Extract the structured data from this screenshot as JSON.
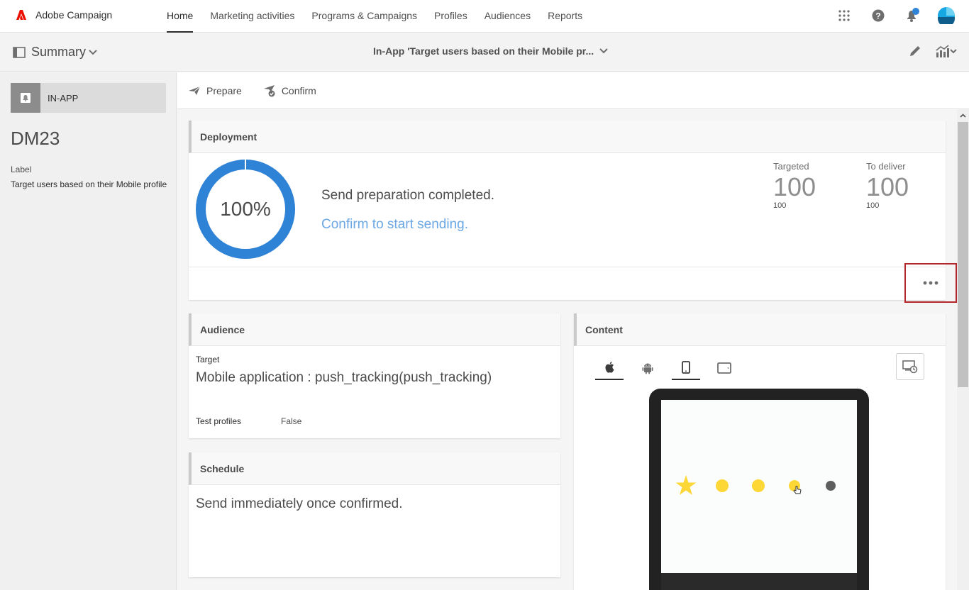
{
  "app": {
    "name": "Adobe Campaign"
  },
  "nav": {
    "items": [
      {
        "label": "Home",
        "active": true
      },
      {
        "label": "Marketing activities",
        "active": false
      },
      {
        "label": "Programs & Campaigns",
        "active": false
      },
      {
        "label": "Profiles",
        "active": false
      },
      {
        "label": "Audiences",
        "active": false
      },
      {
        "label": "Reports",
        "active": false
      }
    ],
    "icons": [
      "apps-grid-icon",
      "help-icon",
      "notification-bell-icon",
      "user-avatar-icon"
    ]
  },
  "subbar": {
    "summary_label": "Summary",
    "delivery_title": "In-App 'Target users based on their Mobile pr..."
  },
  "left": {
    "channel": "IN-APP",
    "code": "DM23",
    "label_caption": "Label",
    "label_value": "Target users based on their Mobile profile"
  },
  "toolbar": {
    "prepare": "Prepare",
    "confirm": "Confirm"
  },
  "deployment": {
    "title": "Deployment",
    "progress_percent": 100,
    "progress_text": "100%",
    "status": "Send preparation completed.",
    "link": "Confirm to start sending.",
    "targeted_label": "Targeted",
    "targeted_value": "100",
    "targeted_sub": "100",
    "deliver_label": "To deliver",
    "deliver_value": "100",
    "deliver_sub": "100"
  },
  "audience": {
    "title": "Audience",
    "target_label": "Target",
    "target_value": "Mobile application : push_tracking(push_tracking)",
    "test_label": "Test profiles",
    "test_value": "False"
  },
  "schedule": {
    "title": "Schedule",
    "text": "Send immediately once confirmed."
  },
  "content": {
    "title": "Content",
    "device_tabs": [
      "apple-icon",
      "android-icon",
      "phone-icon",
      "tablet-icon"
    ],
    "rating": {
      "filled": 4,
      "total": 5
    }
  },
  "colors": {
    "accent_blue": "#2e83d7",
    "link_blue": "#6aa7e4",
    "adobe_red": "#eb1000",
    "highlight_red": "#b3262b",
    "rating_yellow": "#fcd735"
  }
}
